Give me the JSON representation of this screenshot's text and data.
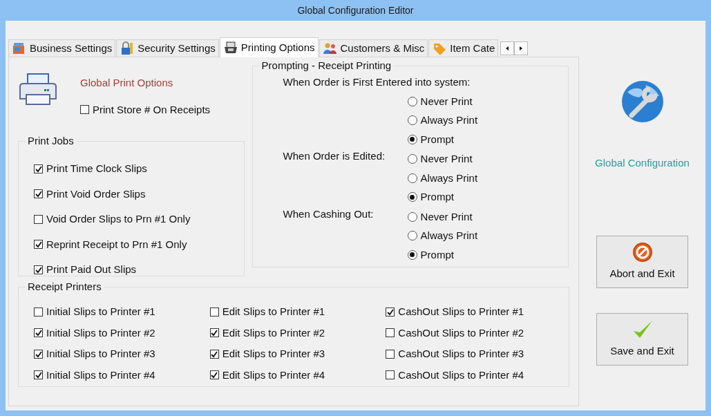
{
  "window": {
    "title": "Global Configuration Editor"
  },
  "tabs": [
    {
      "label": "Business Settings",
      "selected": false
    },
    {
      "label": "Security Settings",
      "selected": false
    },
    {
      "label": "Printing Options",
      "selected": true
    },
    {
      "label": "Customers & Misc",
      "selected": false
    },
    {
      "label": "Item Cate",
      "selected": false
    }
  ],
  "general": {
    "heading": "Global Print Options",
    "store_number": {
      "label": "Print Store # On Receipts",
      "checked": false
    }
  },
  "print_jobs": {
    "title": "Print Jobs",
    "items": [
      {
        "label": "Print Time Clock Slips",
        "checked": true
      },
      {
        "label": "Print Void Order Slips",
        "checked": true
      },
      {
        "label": "Void Order Slips to Prn #1 Only",
        "checked": false
      },
      {
        "label": "Reprint Receipt to Prn #1 Only",
        "checked": true
      },
      {
        "label": "Print Paid Out Slips",
        "checked": true
      }
    ]
  },
  "prompting": {
    "title": "Prompting - Receipt Printing",
    "groups": [
      {
        "label": "When Order is First Entered into system:",
        "kind": "stacked",
        "options": [
          {
            "label": "Never Print",
            "selected": false
          },
          {
            "label": "Always Print",
            "selected": false
          },
          {
            "label": "Prompt",
            "selected": true
          }
        ]
      },
      {
        "label": "When Order is Edited:",
        "kind": "inline",
        "options": [
          {
            "label": "Never Print",
            "selected": false
          },
          {
            "label": "Always Print",
            "selected": false
          },
          {
            "label": "Prompt",
            "selected": true
          }
        ]
      },
      {
        "label": "When Cashing Out:",
        "kind": "inline",
        "options": [
          {
            "label": "Never Print",
            "selected": false
          },
          {
            "label": "Always Print",
            "selected": false
          },
          {
            "label": "Prompt",
            "selected": true
          }
        ]
      }
    ]
  },
  "receipt_printers": {
    "title": "Receipt Printers",
    "columns": [
      {
        "items": [
          {
            "label": "Initial Slips to Printer #1",
            "checked": false
          },
          {
            "label": "Initial Slips to Printer #2",
            "checked": true
          },
          {
            "label": "Initial Slips to Printer #3",
            "checked": true
          },
          {
            "label": "Initial Slips to Printer #4",
            "checked": true
          }
        ]
      },
      {
        "items": [
          {
            "label": "Edit Slips to Printer #1",
            "checked": false
          },
          {
            "label": "Edit Slips to Printer #2",
            "checked": true
          },
          {
            "label": "Edit Slips to Printer #3",
            "checked": true
          },
          {
            "label": "Edit Slips to Printer #4",
            "checked": true
          }
        ]
      },
      {
        "items": [
          {
            "label": "CashOut Slips to Printer #1",
            "checked": true
          },
          {
            "label": "CashOut Slips to Printer #2",
            "checked": false
          },
          {
            "label": "CashOut Slips to Printer #3",
            "checked": false
          },
          {
            "label": "CashOut Slips to Printer #4",
            "checked": false
          }
        ]
      }
    ]
  },
  "sidebar": {
    "caption": "Global Configuration",
    "buttons": [
      {
        "label": "Abort and Exit",
        "kind": "abort"
      },
      {
        "label": "Save and Exit",
        "kind": "save"
      }
    ]
  }
}
